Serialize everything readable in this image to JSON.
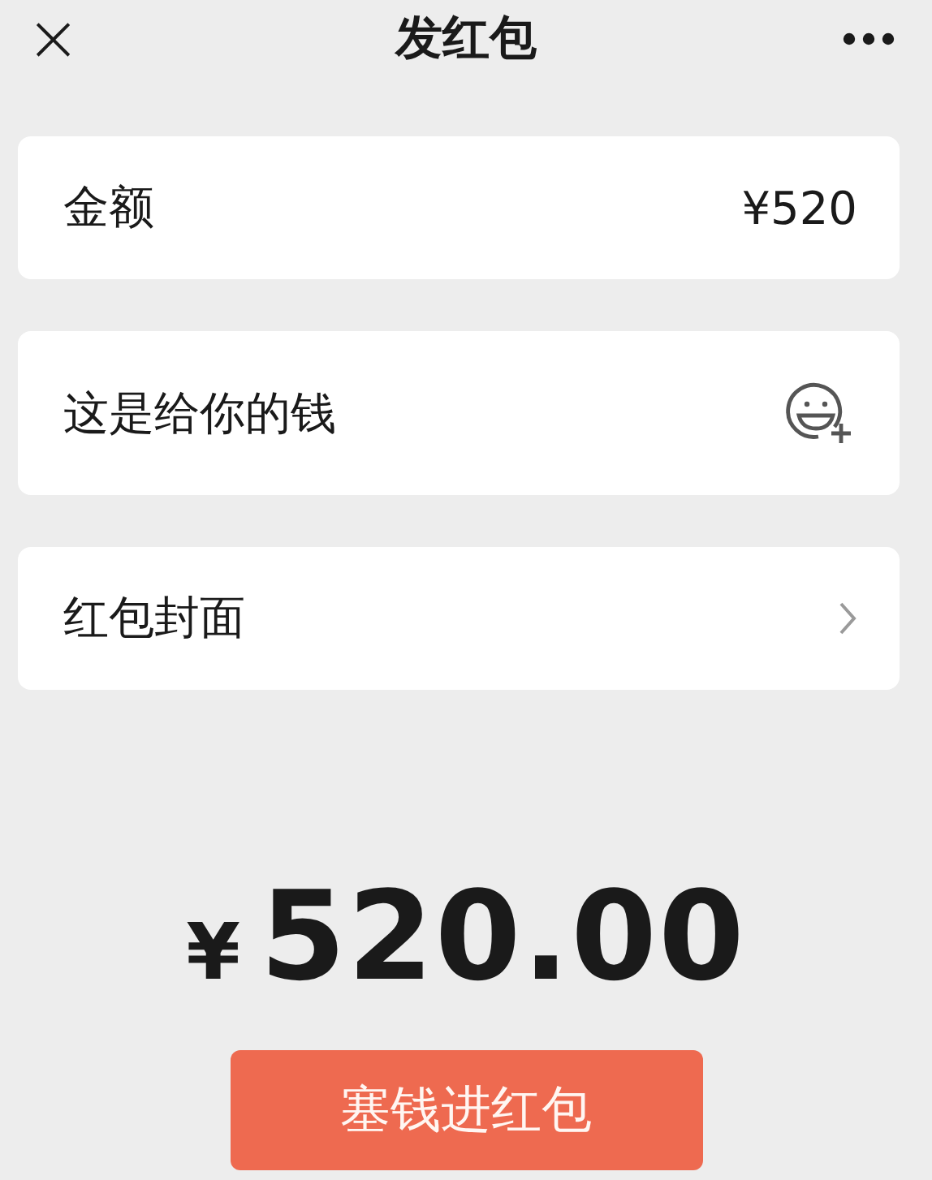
{
  "header": {
    "close": "×",
    "title": "发红包"
  },
  "amount_row": {
    "label": "金额",
    "value": "¥520"
  },
  "greeting_row": {
    "value": "这是给你的钱"
  },
  "cover_row": {
    "label": "红包封面"
  },
  "total": {
    "currency": "¥",
    "amount": "520.00"
  },
  "submit_button": "塞钱进红包"
}
